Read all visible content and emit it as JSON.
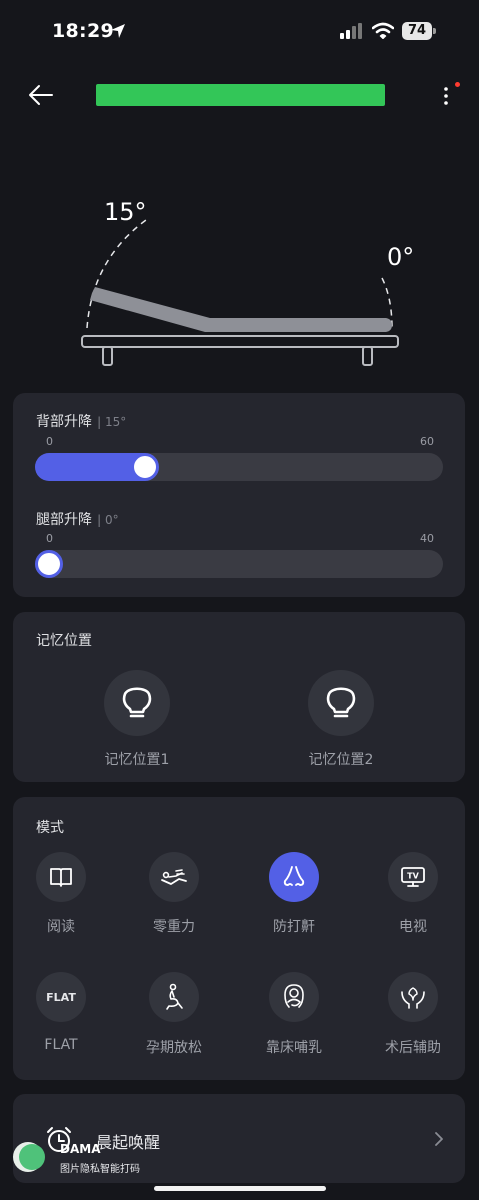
{
  "status_bar": {
    "time": "18:29",
    "battery": "74"
  },
  "bed": {
    "back_angle": "15°",
    "leg_angle": "0°"
  },
  "sliders": {
    "back": {
      "label": "背部升降",
      "value_text": "| 15°",
      "min": "0",
      "max": "60",
      "value": 15
    },
    "leg": {
      "label": "腿部升降",
      "value_text": "| 0°",
      "min": "0",
      "max": "40",
      "value": 0
    }
  },
  "memory": {
    "title": "记忆位置",
    "items": [
      {
        "label": "记忆位置1"
      },
      {
        "label": "记忆位置2"
      }
    ]
  },
  "modes": {
    "title": "模式",
    "items": [
      {
        "label": "阅读",
        "icon": "book-icon"
      },
      {
        "label": "零重力",
        "icon": "zero-gravity-icon"
      },
      {
        "label": "防打鼾",
        "icon": "nose-icon",
        "active": true
      },
      {
        "label": "电视",
        "icon": "tv-icon",
        "badge": "TV"
      },
      {
        "label": "FLAT",
        "icon": "flat-icon",
        "badge": "FLAT"
      },
      {
        "label": "孕期放松",
        "icon": "pregnancy-icon"
      },
      {
        "label": "靠床哺乳",
        "icon": "nursing-icon"
      },
      {
        "label": "术后辅助",
        "icon": "care-hands-icon"
      }
    ]
  },
  "wake": {
    "label": "晨起唤醒"
  },
  "watermark": {
    "brand": "DAMA",
    "caption": "图片隐私智能打码"
  },
  "colors": {
    "accent": "#5360e6",
    "title_bar": "#33c658",
    "background": "#15161b",
    "card": "#25262e"
  }
}
